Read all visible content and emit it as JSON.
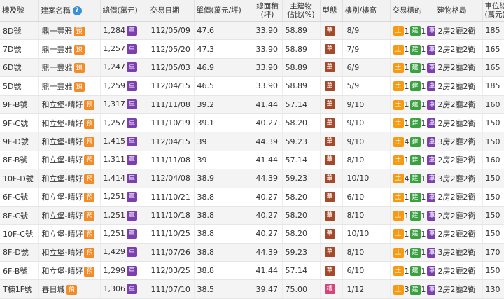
{
  "colors": {
    "car": "#7b3fb0",
    "pre_sale": "#f28c28",
    "type_hua": "#a5492b",
    "type_lou": "#d6457a",
    "land": "#f59a12",
    "build": "#3aa140",
    "car_count": "#7b3fb0",
    "header_bg": "#f2f2f2"
  },
  "headers": {
    "building": "棟及號",
    "project": "建案名稱",
    "help": "?",
    "total": "總價(萬元)",
    "date": "交易日期",
    "unit": "單價(萬元/坪)",
    "area_1": "總面積",
    "area_2": "(坪)",
    "main_1": "主建物",
    "main_2": "佔比(%)",
    "type": "型態",
    "floor": "樓別/樓高",
    "target": "交易標的",
    "layout": "建物格局",
    "car_1": "車位總價",
    "car_2": "(萬元)"
  },
  "badge_labels": {
    "car": "車",
    "pre_sale": "預",
    "land": "土",
    "build": "建",
    "car_count": "車"
  },
  "rows": [
    {
      "building": "8D號",
      "project": "鼎一豐雅",
      "total": "1,284",
      "date": "112/05/09",
      "unit": "47.6",
      "area": "33.90",
      "main": "58.89",
      "type": "華",
      "floor": "8/9",
      "land": "1",
      "build": "1",
      "car": "1",
      "layout": "2房2廳2衛",
      "car_price": "185"
    },
    {
      "building": "7D號",
      "project": "鼎一豐雅",
      "total": "1,257",
      "date": "112/05/20",
      "unit": "47.3",
      "area": "33.90",
      "main": "58.89",
      "type": "華",
      "floor": "7/9",
      "land": "1",
      "build": "1",
      "car": "1",
      "layout": "2房2廳2衛",
      "car_price": "165"
    },
    {
      "building": "6D號",
      "project": "鼎一豐雅",
      "total": "1,247",
      "date": "112/05/03",
      "unit": "46.9",
      "area": "33.90",
      "main": "58.89",
      "type": "華",
      "floor": "6/9",
      "land": "1",
      "build": "1",
      "car": "1",
      "layout": "2房2廳2衛",
      "car_price": "165"
    },
    {
      "building": "5D號",
      "project": "鼎一豐雅",
      "total": "1,259",
      "date": "112/04/15",
      "unit": "46.5",
      "area": "33.90",
      "main": "58.89",
      "type": "華",
      "floor": "5/9",
      "land": "1",
      "build": "1",
      "car": "1",
      "layout": "2房2廳2衛",
      "car_price": "185"
    },
    {
      "building": "9F-B號",
      "project": "和立堡-晴好",
      "total": "1,317",
      "date": "111/11/08",
      "unit": "39.2",
      "area": "41.44",
      "main": "57.14",
      "type": "華",
      "floor": "9/10",
      "land": "1",
      "build": "1",
      "car": "1",
      "layout": "2房2廳2衛",
      "car_price": "160"
    },
    {
      "building": "9F-C號",
      "project": "和立堡-晴好",
      "total": "1,257",
      "date": "111/10/19",
      "unit": "39.1",
      "area": "40.27",
      "main": "58.20",
      "type": "華",
      "floor": "9/10",
      "land": "1",
      "build": "1",
      "car": "1",
      "layout": "2房2廳2衛",
      "car_price": "150"
    },
    {
      "building": "9F-D號",
      "project": "和立堡-晴好",
      "total": "1,415",
      "date": "112/04/15",
      "unit": "39",
      "area": "44.39",
      "main": "59.23",
      "type": "華",
      "floor": "9/10",
      "land": "4",
      "build": "1",
      "car": "1",
      "layout": "3房2廳2衛",
      "car_price": "150"
    },
    {
      "building": "8F-B號",
      "project": "和立堡-晴好",
      "total": "1,311",
      "date": "111/11/08",
      "unit": "39",
      "area": "41.44",
      "main": "57.14",
      "type": "華",
      "floor": "8/10",
      "land": "1",
      "build": "1",
      "car": "1",
      "layout": "2房2廳2衛",
      "car_price": "160"
    },
    {
      "building": "10F-D號",
      "project": "和立堡-晴好",
      "total": "1,414",
      "date": "112/04/08",
      "unit": "38.9",
      "area": "44.39",
      "main": "59.23",
      "type": "華",
      "floor": "10/10",
      "land": "4",
      "build": "1",
      "car": "1",
      "layout": "3房2廳2衛",
      "car_price": "150"
    },
    {
      "building": "6F-C號",
      "project": "和立堡-晴好",
      "total": "1,251",
      "date": "111/10/21",
      "unit": "38.8",
      "area": "40.27",
      "main": "58.20",
      "type": "華",
      "floor": "6/10",
      "land": "1",
      "build": "1",
      "car": "1",
      "layout": "2房2廳2衛",
      "car_price": "150"
    },
    {
      "building": "8F-C號",
      "project": "和立堡-晴好",
      "total": "1,251",
      "date": "111/10/18",
      "unit": "38.8",
      "area": "40.27",
      "main": "58.20",
      "type": "華",
      "floor": "8/10",
      "land": "1",
      "build": "1",
      "car": "1",
      "layout": "2房2廳2衛",
      "car_price": "150"
    },
    {
      "building": "10F-C號",
      "project": "和立堡-晴好",
      "total": "1,251",
      "date": "111/10/25",
      "unit": "38.8",
      "area": "40.27",
      "main": "58.20",
      "type": "華",
      "floor": "10/10",
      "land": "1",
      "build": "1",
      "car": "1",
      "layout": "2房2廳2衛",
      "car_price": "150"
    },
    {
      "building": "8F-D號",
      "project": "和立堡-晴好",
      "total": "1,429",
      "date": "111/07/26",
      "unit": "38.8",
      "area": "44.39",
      "main": "59.23",
      "type": "華",
      "floor": "8/10",
      "land": "4",
      "build": "1",
      "car": "1",
      "layout": "3房2廳2衛",
      "car_price": "170"
    },
    {
      "building": "6F-B號",
      "project": "和立堡-晴好",
      "total": "1,299",
      "date": "112/03/25",
      "unit": "38.8",
      "area": "41.44",
      "main": "57.14",
      "type": "華",
      "floor": "6/10",
      "land": "1",
      "build": "1",
      "car": "1",
      "layout": "2房2廳2衛",
      "car_price": "150"
    },
    {
      "building": "T棟1F號",
      "project": "春日城",
      "total": "1,306",
      "date": "111/07/10",
      "unit": "38.5",
      "area": "39.47",
      "main": "75.00",
      "type": "樓",
      "floor": "1/12",
      "land": "3",
      "build": "1",
      "car": "1",
      "layout": "2房2廳2衛",
      "car_price": "130"
    }
  ]
}
